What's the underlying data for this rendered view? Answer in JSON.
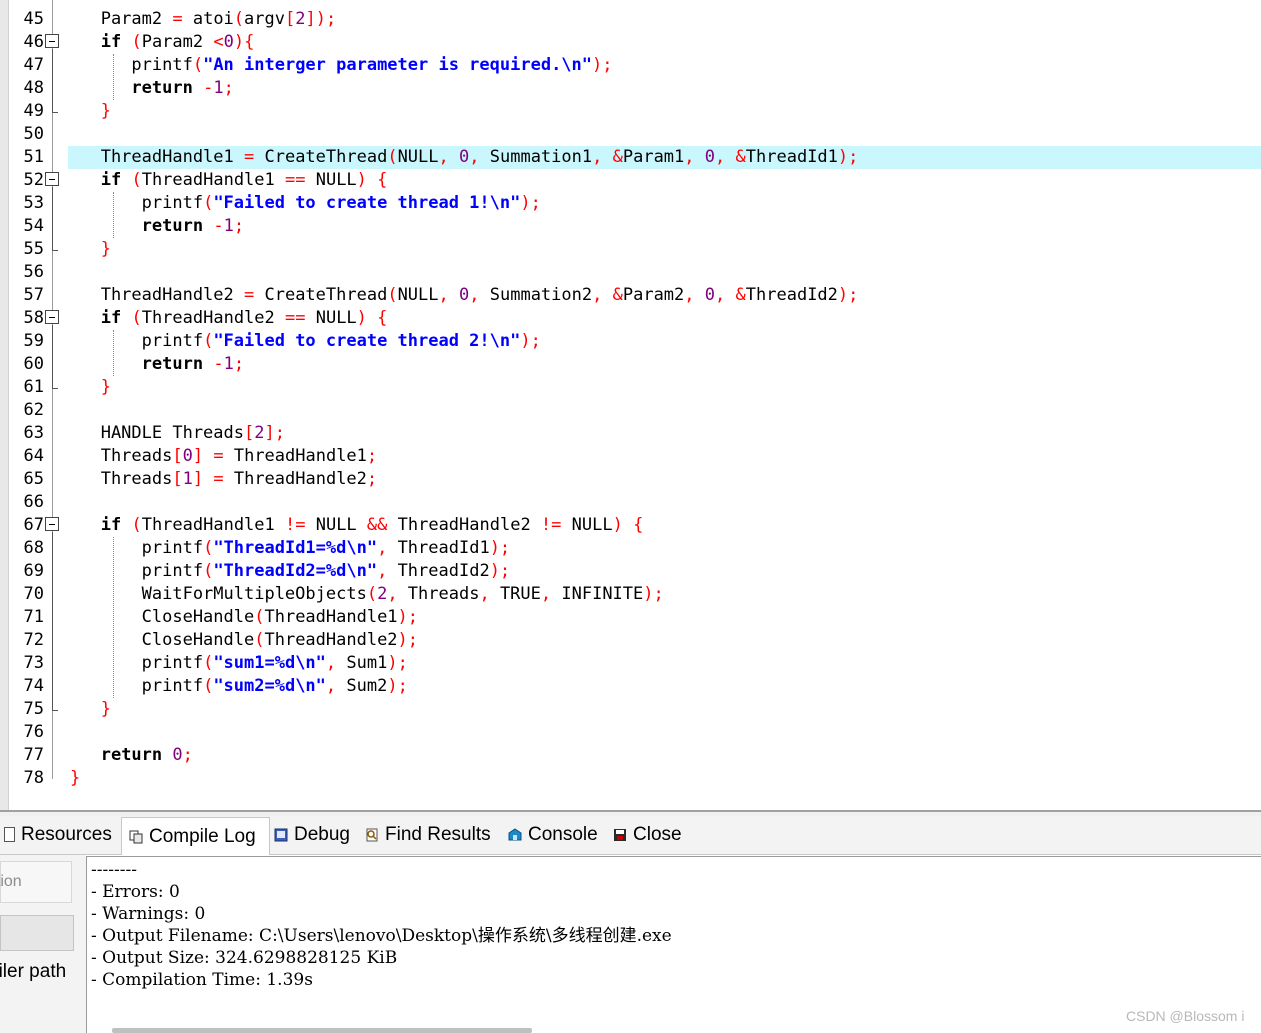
{
  "editor": {
    "lines": [
      {
        "num": "45",
        "html": "   Param2 <span class=\"p\">=</span> atoi<span class=\"p\">(</span>argv<span class=\"p\">[</span><span class=\"n\">2</span><span class=\"p\">]);</span>"
      },
      {
        "num": "46",
        "html": "   <span class=\"kw\">if</span> <span class=\"p\">(</span>Param2 <span class=\"p\">&lt;</span><span class=\"n\">0</span><span class=\"p\">){</span>"
      },
      {
        "num": "47",
        "html": "      printf<span class=\"p\">(</span><span class=\"s\">\"An interger parameter is required.\\n\"</span><span class=\"p\">);</span>"
      },
      {
        "num": "48",
        "html": "      <span class=\"kw\">return</span> <span class=\"p\">-</span><span class=\"n\">1</span><span class=\"p\">;</span>"
      },
      {
        "num": "49",
        "html": "   <span class=\"p\">}</span>"
      },
      {
        "num": "50",
        "html": ""
      },
      {
        "num": "51",
        "html": "   ThreadHandle1 <span class=\"p\">=</span> CreateThread<span class=\"p\">(</span>NULL<span class=\"p\">,</span> <span class=\"n\">0</span><span class=\"p\">,</span> Summation1<span class=\"p\">,</span> <span class=\"p\">&amp;</span>Param1<span class=\"p\">,</span> <span class=\"n\">0</span><span class=\"p\">,</span> <span class=\"p\">&amp;</span>ThreadId1<span class=\"p\">);</span>"
      },
      {
        "num": "52",
        "html": "   <span class=\"kw\">if</span> <span class=\"p\">(</span>ThreadHandle1 <span class=\"p\">==</span> NULL<span class=\"p\">)</span> <span class=\"p\">{</span>"
      },
      {
        "num": "53",
        "html": "       printf<span class=\"p\">(</span><span class=\"s\">\"Failed to create thread 1!\\n\"</span><span class=\"p\">);</span>"
      },
      {
        "num": "54",
        "html": "       <span class=\"kw\">return</span> <span class=\"p\">-</span><span class=\"n\">1</span><span class=\"p\">;</span>"
      },
      {
        "num": "55",
        "html": "   <span class=\"p\">}</span>"
      },
      {
        "num": "56",
        "html": ""
      },
      {
        "num": "57",
        "html": "   ThreadHandle2 <span class=\"p\">=</span> CreateThread<span class=\"p\">(</span>NULL<span class=\"p\">,</span> <span class=\"n\">0</span><span class=\"p\">,</span> Summation2<span class=\"p\">,</span> <span class=\"p\">&amp;</span>Param2<span class=\"p\">,</span> <span class=\"n\">0</span><span class=\"p\">,</span> <span class=\"p\">&amp;</span>ThreadId2<span class=\"p\">);</span>"
      },
      {
        "num": "58",
        "html": "   <span class=\"kw\">if</span> <span class=\"p\">(</span>ThreadHandle2 <span class=\"p\">==</span> NULL<span class=\"p\">)</span> <span class=\"p\">{</span>"
      },
      {
        "num": "59",
        "html": "       printf<span class=\"p\">(</span><span class=\"s\">\"Failed to create thread 2!\\n\"</span><span class=\"p\">);</span>"
      },
      {
        "num": "60",
        "html": "       <span class=\"kw\">return</span> <span class=\"p\">-</span><span class=\"n\">1</span><span class=\"p\">;</span>"
      },
      {
        "num": "61",
        "html": "   <span class=\"p\">}</span>"
      },
      {
        "num": "62",
        "html": ""
      },
      {
        "num": "63",
        "html": "   HANDLE Threads<span class=\"p\">[</span><span class=\"n\">2</span><span class=\"p\">];</span>"
      },
      {
        "num": "64",
        "html": "   Threads<span class=\"p\">[</span><span class=\"n\">0</span><span class=\"p\">]</span> <span class=\"p\">=</span> ThreadHandle1<span class=\"p\">;</span>"
      },
      {
        "num": "65",
        "html": "   Threads<span class=\"p\">[</span><span class=\"n\">1</span><span class=\"p\">]</span> <span class=\"p\">=</span> ThreadHandle2<span class=\"p\">;</span>"
      },
      {
        "num": "66",
        "html": ""
      },
      {
        "num": "67",
        "html": "   <span class=\"kw\">if</span> <span class=\"p\">(</span>ThreadHandle1 <span class=\"p\">!=</span> NULL <span class=\"p\">&amp;&amp;</span> ThreadHandle2 <span class=\"p\">!=</span> NULL<span class=\"p\">)</span> <span class=\"p\">{</span>"
      },
      {
        "num": "68",
        "html": "       printf<span class=\"p\">(</span><span class=\"s\">\"ThreadId1=%d\\n\"</span><span class=\"p\">,</span> ThreadId1<span class=\"p\">);</span>"
      },
      {
        "num": "69",
        "html": "       printf<span class=\"p\">(</span><span class=\"s\">\"ThreadId2=%d\\n\"</span><span class=\"p\">,</span> ThreadId2<span class=\"p\">);</span>"
      },
      {
        "num": "70",
        "html": "       WaitForMultipleObjects<span class=\"p\">(</span><span class=\"n\">2</span><span class=\"p\">,</span> Threads<span class=\"p\">,</span> TRUE<span class=\"p\">,</span> INFINITE<span class=\"p\">);</span>"
      },
      {
        "num": "71",
        "html": "       CloseHandle<span class=\"p\">(</span>ThreadHandle1<span class=\"p\">);</span>"
      },
      {
        "num": "72",
        "html": "       CloseHandle<span class=\"p\">(</span>ThreadHandle2<span class=\"p\">);</span>"
      },
      {
        "num": "73",
        "html": "       printf<span class=\"p\">(</span><span class=\"s\">\"sum1=%d\\n\"</span><span class=\"p\">,</span> Sum1<span class=\"p\">);</span>"
      },
      {
        "num": "74",
        "html": "       printf<span class=\"p\">(</span><span class=\"s\">\"sum2=%d\\n\"</span><span class=\"p\">,</span> Sum2<span class=\"p\">);</span>"
      },
      {
        "num": "75",
        "html": "   <span class=\"p\">}</span>"
      },
      {
        "num": "76",
        "html": ""
      },
      {
        "num": "77",
        "html": "   <span class=\"kw\">return</span> <span class=\"n\">0</span><span class=\"p\">;</span>"
      },
      {
        "num": "78",
        "html": "<span class=\"p\">}</span>"
      }
    ],
    "fold_lines": [
      "46",
      "52",
      "58",
      "67"
    ],
    "highlighted_line": "51"
  },
  "tabs": [
    {
      "label": "Resources",
      "icon": "resources-icon",
      "active": false
    },
    {
      "label": "Compile Log",
      "icon": "compile-log-icon",
      "active": true
    },
    {
      "label": "Debug",
      "icon": "debug-icon",
      "active": false
    },
    {
      "label": "Find Results",
      "icon": "find-results-icon",
      "active": false
    },
    {
      "label": "Console",
      "icon": "console-icon",
      "active": false
    },
    {
      "label": "Close",
      "icon": "close-icon",
      "active": false
    }
  ],
  "side_panel": {
    "field_text": "ation",
    "label": "piler path"
  },
  "compile_log": [
    "--------",
    "- Errors: 0",
    "- Warnings: 0",
    "- Output Filename: C:\\Users\\lenovo\\Desktop\\操作系统\\多线程创建.exe",
    "- Output Size: 324.6298828125 KiB",
    "- Compilation Time: 1.39s"
  ],
  "watermark": "CSDN @Blossom i",
  "colors": {
    "keyword": "#000000",
    "string": "#0000ff",
    "number": "#800080",
    "punctuation": "#ff0000",
    "highlight": "#c9f7fd"
  }
}
